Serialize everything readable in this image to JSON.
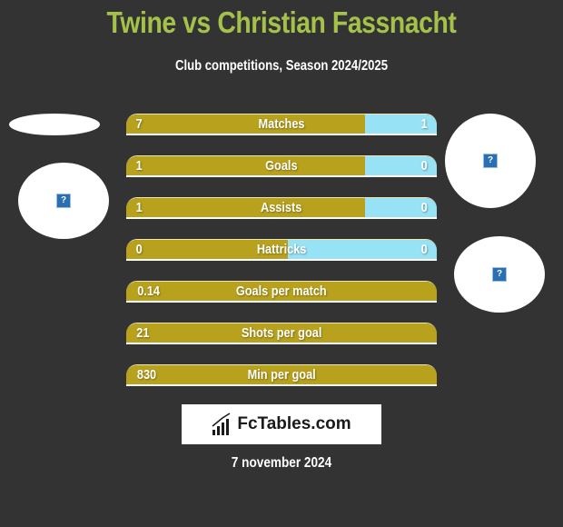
{
  "header": {
    "title": "Twine vs Christian Fassnacht",
    "subtitle": "Club competitions, Season 2024/2025"
  },
  "colors": {
    "title": "#a4c14a",
    "left_bar": "#b8a11c",
    "right_bar": "#98e2f6",
    "background": "#333333"
  },
  "players": {
    "left": {
      "name": "Twine",
      "avatar_icon": "missing-image-icon"
    },
    "right": {
      "name": "Christian Fassnacht",
      "avatar_icon": "missing-image-icon"
    }
  },
  "stats": [
    {
      "label": "Matches",
      "left": "7",
      "right": "1",
      "left_share": 0.77
    },
    {
      "label": "Goals",
      "left": "1",
      "right": "0",
      "left_share": 0.77
    },
    {
      "label": "Assists",
      "left": "1",
      "right": "0",
      "left_share": 0.77
    },
    {
      "label": "Hattricks",
      "left": "0",
      "right": "0",
      "left_share": 0.52
    },
    {
      "label": "Goals per match",
      "left": "0.14",
      "right": "",
      "left_share": 1.0
    },
    {
      "label": "Shots per goal",
      "left": "21",
      "right": "",
      "left_share": 1.0
    },
    {
      "label": "Min per goal",
      "left": "830",
      "right": "",
      "left_share": 1.0
    }
  ],
  "logo": {
    "text": "FcTables.com",
    "icon": "bar-chart-icon"
  },
  "date": "7 november 2024"
}
